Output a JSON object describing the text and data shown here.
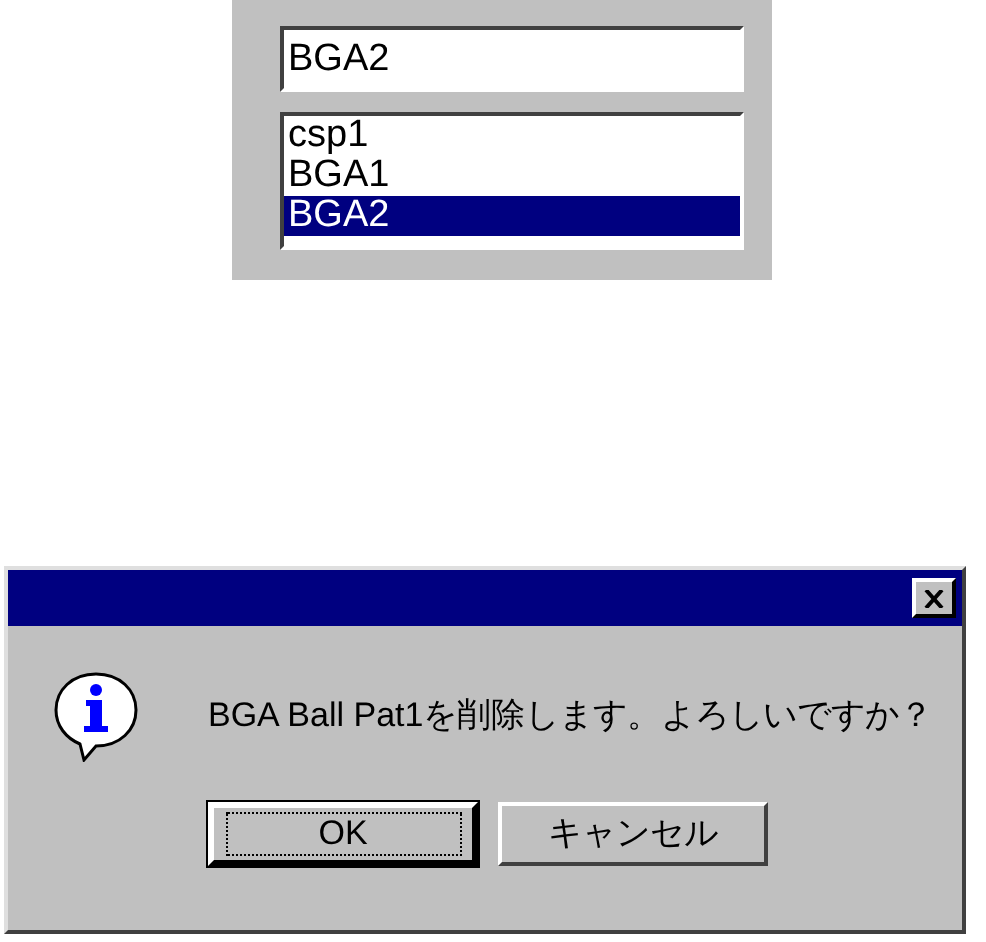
{
  "name_field": {
    "value": "BGA2"
  },
  "list": [
    {
      "label": "csp1",
      "selected": false
    },
    {
      "label": "BGA1",
      "selected": false
    },
    {
      "label": "BGA2",
      "selected": true
    }
  ],
  "dialog": {
    "message": "BGA Ball Pat1を削除します。よろしいですか？",
    "buttons": [
      {
        "label": "OK",
        "default": true
      },
      {
        "label": "キャンセル",
        "default": false
      }
    ]
  }
}
